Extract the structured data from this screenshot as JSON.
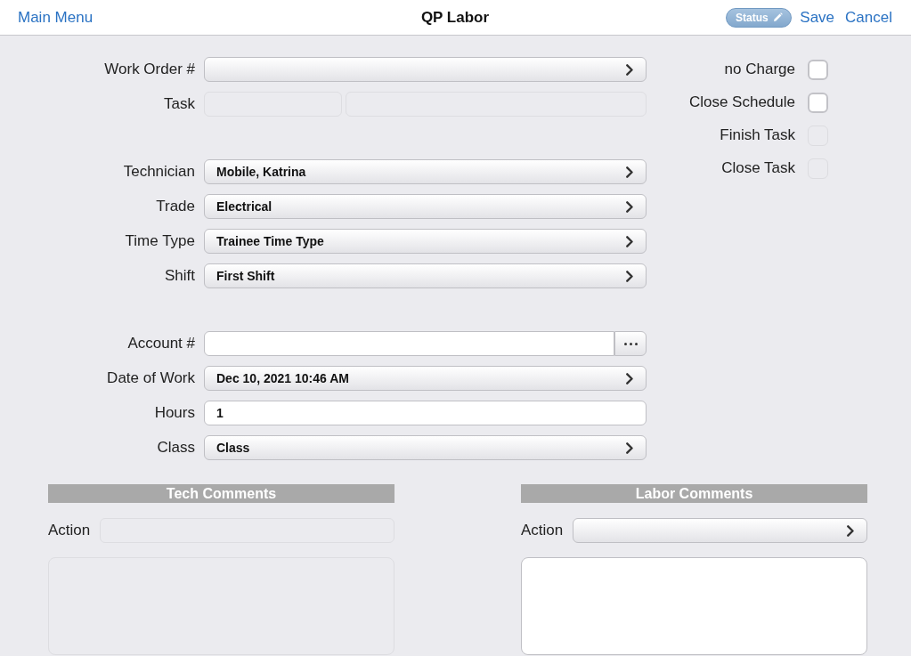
{
  "nav": {
    "back": "Main Menu",
    "title": "QP Labor",
    "status": "Status",
    "buttons": [
      "Save",
      "Cancel"
    ]
  },
  "form": {
    "groups": [
      {
        "fields": [
          {
            "label": "Work Order #",
            "kind": "picker",
            "disabled": false
          },
          {
            "label": "Task",
            "kind": "split",
            "disabled": true
          }
        ]
      },
      {
        "fields": [
          {
            "label": "Technician",
            "kind": "picker",
            "value": "Mobile, Katrina",
            "disabled": false
          },
          {
            "label": "Trade",
            "kind": "picker",
            "value": "Electrical",
            "disabled": false
          },
          {
            "label": "Time Type",
            "kind": "picker",
            "value": "Trainee Time Type",
            "disabled": false
          },
          {
            "label": "Shift",
            "kind": "picker",
            "value": "First Shift",
            "disabled": false
          }
        ]
      },
      {
        "fields": [
          {
            "label": "Account #",
            "kind": "input_more",
            "disabled": false
          },
          {
            "label": "Date of Work",
            "kind": "picker",
            "value": "Dec 10, 2021 10:46 AM",
            "disabled": false
          },
          {
            "label": "Hours",
            "kind": "input",
            "value": "1",
            "disabled": false
          },
          {
            "label": "Class",
            "kind": "picker",
            "value": "Class",
            "disabled": false
          }
        ]
      }
    ]
  },
  "checkboxes": [
    {
      "label": "no Charge",
      "checked": false,
      "disabled": false
    },
    {
      "label": "Close Schedule",
      "checked": false,
      "disabled": false
    },
    {
      "label": "Finish Task",
      "checked": false,
      "disabled": true
    },
    {
      "label": "Close Task",
      "checked": false,
      "disabled": true
    }
  ],
  "comment_panels": [
    {
      "title": "Tech Comments",
      "action_label": "Action",
      "disabled": true
    },
    {
      "title": "Labor Comments",
      "action_label": "Action",
      "disabled": false
    }
  ]
}
